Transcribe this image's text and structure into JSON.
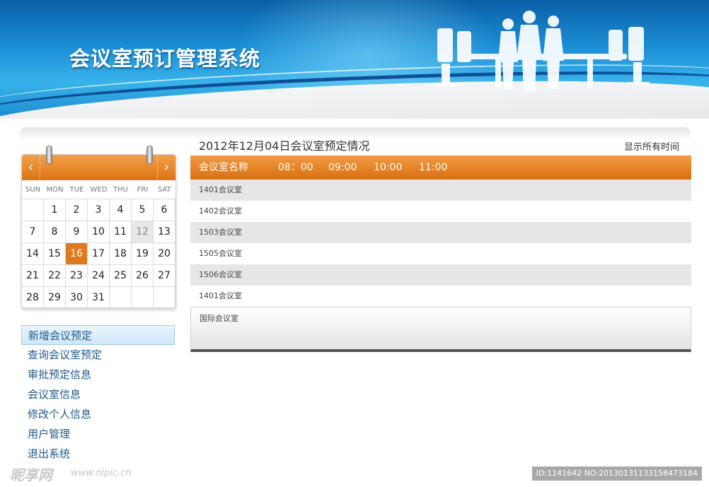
{
  "header": {
    "app_title": "会议室预订管理系统"
  },
  "calendar": {
    "prev_label": "‹",
    "next_label": "›",
    "weekdays": [
      "SUN",
      "MON",
      "TUE",
      "WED",
      "THU",
      "FRI",
      "SAT"
    ],
    "weeks": [
      [
        "",
        "1",
        "2",
        "3",
        "4",
        "5",
        "6"
      ],
      [
        "7",
        "8",
        "9",
        "10",
        "11",
        "12",
        "13"
      ],
      [
        "14",
        "15",
        "16",
        "17",
        "18",
        "19",
        "20"
      ],
      [
        "21",
        "22",
        "23",
        "24",
        "25",
        "26",
        "27"
      ],
      [
        "28",
        "29",
        "30",
        "31",
        "",
        "",
        ""
      ]
    ],
    "highlighted_day": "12",
    "selected_day": "16",
    "accent_color": "#de7a1c"
  },
  "menu": {
    "items": [
      {
        "label": "新增会议预定",
        "active": true
      },
      {
        "label": "查询会议室预定",
        "active": false
      },
      {
        "label": "审批预定信息",
        "active": false
      },
      {
        "label": "会议室信息",
        "active": false
      },
      {
        "label": "修改个人信息",
        "active": false
      },
      {
        "label": "用户管理",
        "active": false
      },
      {
        "label": "退出系统",
        "active": false
      }
    ]
  },
  "schedule": {
    "title": "2012年12月04日会议室预定情况",
    "show_all_label": "显示所有时间",
    "header": {
      "room_col": "会议室名称",
      "times": [
        "08：00",
        "09:00",
        "10:00",
        "11:00"
      ]
    },
    "rooms": [
      "1401会议室",
      "1402会议室",
      "1503会议室",
      "1505会议室",
      "1506会议室",
      "1401会议室",
      "国际会议室"
    ],
    "header_color": "#de7a1c"
  },
  "watermark": {
    "logo": "昵享网",
    "url": "www.nipic.cn",
    "id_text": "ID:1141642 NO:20130131133158473184"
  }
}
